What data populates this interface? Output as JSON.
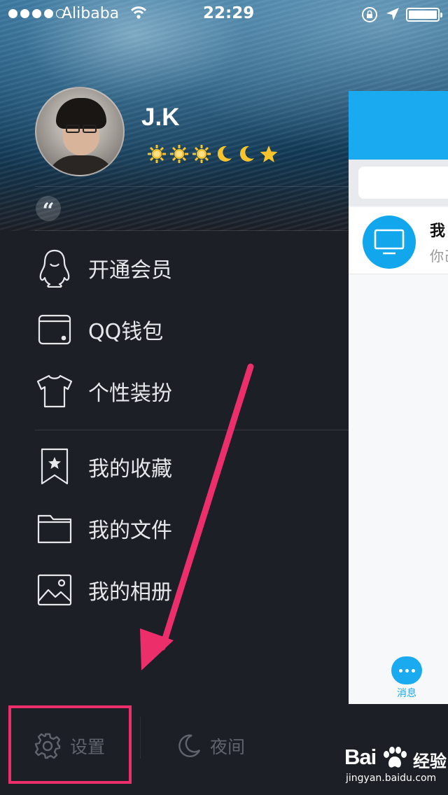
{
  "status_bar": {
    "carrier": "Alibaba",
    "time": "22:29",
    "signal_bars_filled": 4,
    "signal_bars_total": 5
  },
  "profile": {
    "name": "J.K",
    "levels": [
      "sun",
      "sun",
      "sun",
      "moon",
      "moon",
      "star"
    ]
  },
  "menu": {
    "items": [
      {
        "label": "开通会员",
        "icon": "penguin-icon"
      },
      {
        "label": "QQ钱包",
        "icon": "wallet-icon"
      },
      {
        "label": "个性装扮",
        "icon": "tshirt-icon"
      },
      {
        "label": "我的收藏",
        "icon": "bookmark-star-icon"
      },
      {
        "label": "我的文件",
        "icon": "folder-icon"
      },
      {
        "label": "我的相册",
        "icon": "photo-icon"
      }
    ]
  },
  "main_panel": {
    "chat_title": "我",
    "chat_preview": "你己",
    "tab_label": "消息"
  },
  "bottom_bar": {
    "settings_label": "设置",
    "night_label": "夜间"
  },
  "watermark": {
    "logo": "Bai",
    "logo_suffix": "经验",
    "url": "jingyan.baidu.com"
  },
  "colors": {
    "drawer_bg": "#1c1f26",
    "accent_blue": "#1aaaf0",
    "annotation_pink": "#ec2e6a",
    "star_gold": "#f6c42c"
  }
}
